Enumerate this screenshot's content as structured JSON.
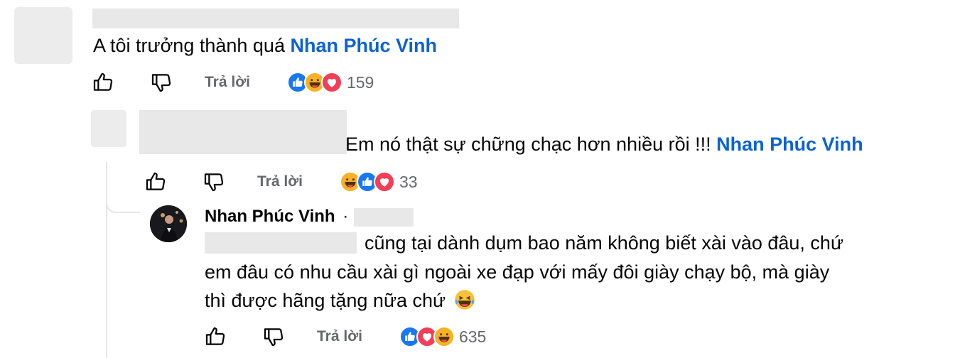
{
  "comments": [
    {
      "text": "A tôi trưởng thành quá ",
      "mention": "Nhan Phúc Vinh",
      "reply_label": "Trả lời",
      "reactions": [
        "like",
        "haha",
        "love"
      ],
      "reaction_count": "159"
    },
    {
      "text": "Em nó thật sự chững chạc hơn nhiều rồi !!! ",
      "mention": "Nhan Phúc Vinh",
      "reply_label": "Trả lời",
      "reactions": [
        "haha",
        "like",
        "love"
      ],
      "reaction_count": "33"
    },
    {
      "author": "Nhan Phúc Vinh",
      "author_sep": "·",
      "lines": [
        "cũng tại dành dụm bao năm không biết xài vào đâu, chứ",
        "em đâu có nhu cầu xài gì ngoài xe đạp với mấy đôi giày chạy bộ, mà giày",
        "thì được hãng tặng nữa chứ"
      ],
      "emoji": "😂",
      "reply_label": "Trả lời",
      "reactions": [
        "like",
        "love",
        "haha"
      ],
      "reaction_count": "635"
    }
  ],
  "icons": {
    "like": "thumbs-up-outline-icon",
    "dislike": "thumbs-down-outline-icon",
    "react_like": "like-reaction-icon",
    "react_love": "love-reaction-icon",
    "react_haha": "haha-reaction-icon"
  },
  "colors": {
    "mention": "#0b62d6",
    "muted": "#65676b",
    "like_blue": "#1877f2",
    "love_red": "#f33e58",
    "haha_yellow": "#f7b125"
  }
}
